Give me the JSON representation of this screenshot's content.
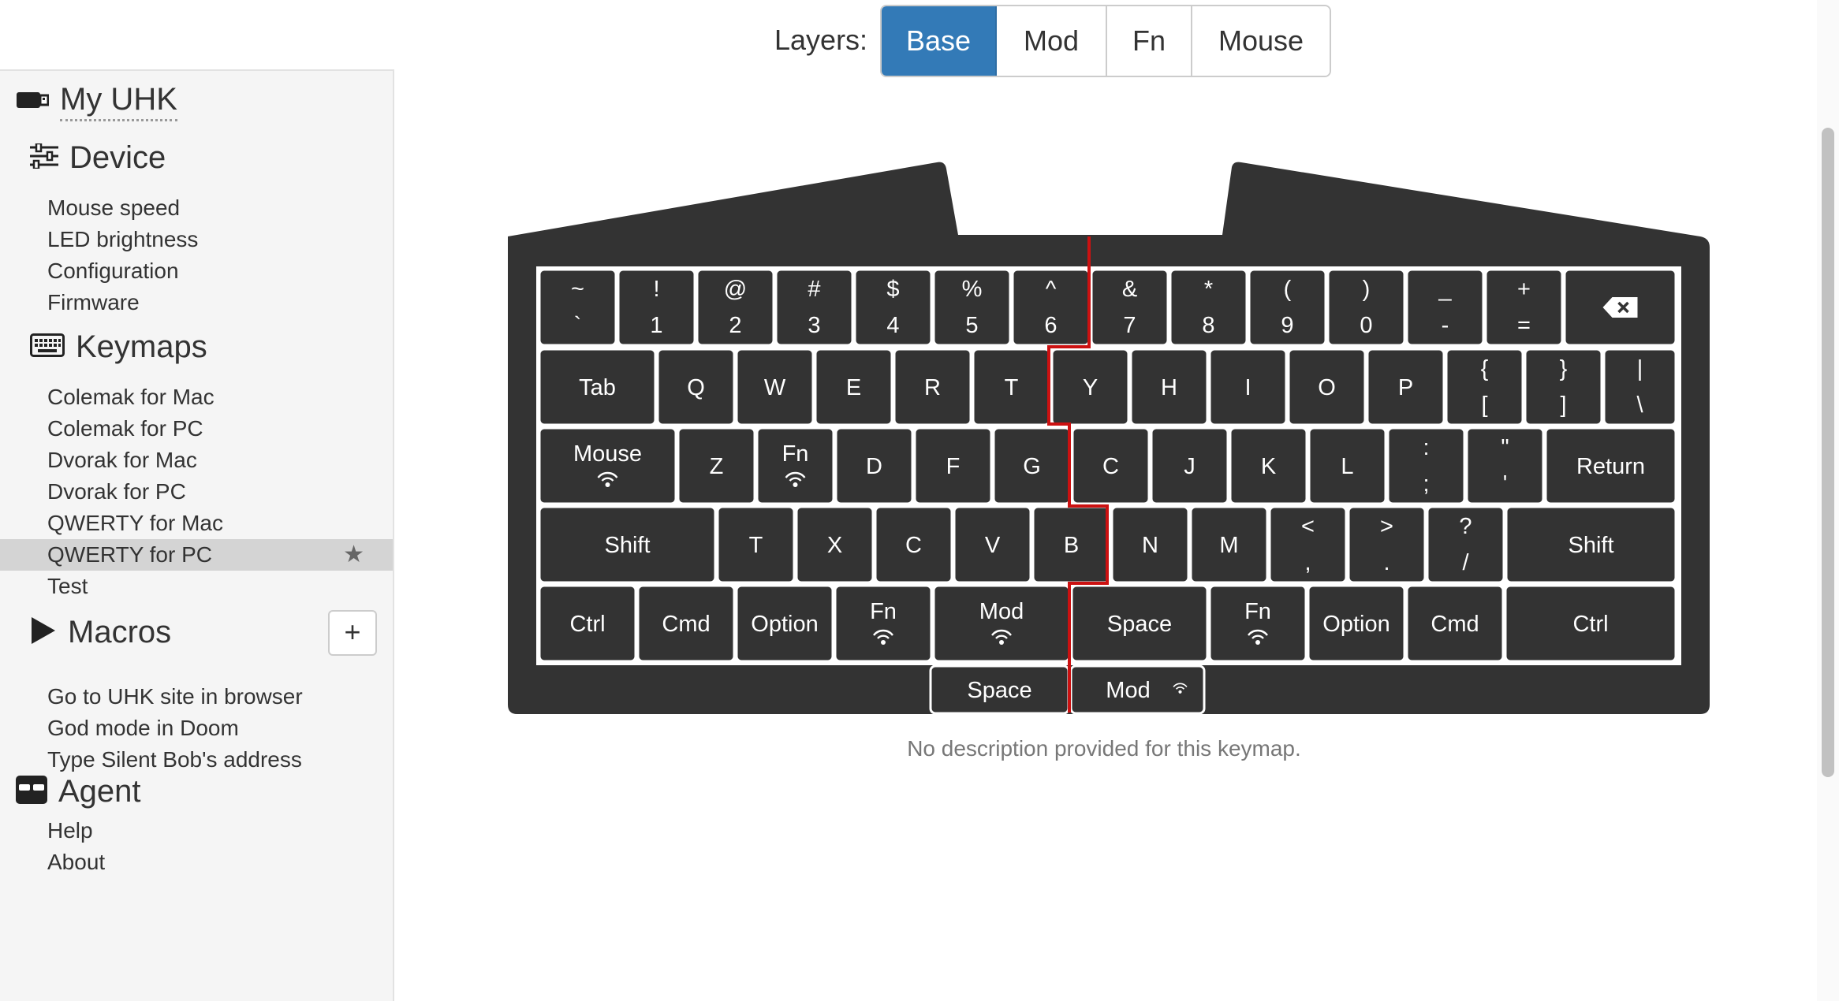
{
  "layers": {
    "label": "Layers:",
    "buttons": [
      "Base",
      "Mod",
      "Fn",
      "Mouse"
    ],
    "active": "Base"
  },
  "sidebar": {
    "my_uhk": "My UHK",
    "device": {
      "title": "Device",
      "items": [
        "Mouse speed",
        "LED brightness",
        "Configuration",
        "Firmware"
      ]
    },
    "keymaps": {
      "title": "Keymaps",
      "items": [
        "Colemak for Mac",
        "Colemak for PC",
        "Dvorak for Mac",
        "Dvorak for PC",
        "QWERTY for Mac",
        "QWERTY for PC",
        "Test"
      ],
      "selected": "QWERTY for PC"
    },
    "macros": {
      "title": "Macros",
      "add_label": "+",
      "items": [
        "Go to UHK site in browser",
        "God mode in Doom",
        "Type Silent Bob's address"
      ]
    },
    "agent": {
      "title": "Agent",
      "items": [
        "Help",
        "About"
      ]
    }
  },
  "description": "No description provided for this keymap.",
  "colors": {
    "accent": "#337ab7",
    "key": "#333333",
    "case": "#333333",
    "split_line": "#cc1111",
    "selected_row": "#d4d4d4"
  },
  "keys": {
    "row1": [
      {
        "top": "~",
        "bottom": "`"
      },
      {
        "top": "!",
        "bottom": "1"
      },
      {
        "top": "@",
        "bottom": "2"
      },
      {
        "top": "#",
        "bottom": "3"
      },
      {
        "top": "$",
        "bottom": "4"
      },
      {
        "top": "%",
        "bottom": "5"
      },
      {
        "top": "^",
        "bottom": "6"
      },
      {
        "top": "&",
        "bottom": "7"
      },
      {
        "top": "*",
        "bottom": "8"
      },
      {
        "top": "(",
        "bottom": "9"
      },
      {
        "top": ")",
        "bottom": "0"
      },
      {
        "top": "_",
        "bottom": "-"
      },
      {
        "top": "+",
        "bottom": "="
      },
      {
        "icon": "backspace-icon"
      }
    ],
    "row2": [
      {
        "label": "Tab"
      },
      {
        "label": "Q"
      },
      {
        "label": "W"
      },
      {
        "label": "E"
      },
      {
        "label": "R"
      },
      {
        "label": "T"
      },
      {
        "label": "Y"
      },
      {
        "label": "H"
      },
      {
        "label": "I"
      },
      {
        "label": "O"
      },
      {
        "label": "P"
      },
      {
        "top": "{",
        "bottom": "["
      },
      {
        "top": "}",
        "bottom": "]"
      },
      {
        "top": "|",
        "bottom": "\\"
      }
    ],
    "row3": [
      {
        "label": "Mouse",
        "icon": "layer-switch-icon"
      },
      {
        "label": "Z"
      },
      {
        "label": "Fn",
        "icon": "layer-switch-icon"
      },
      {
        "label": "D"
      },
      {
        "label": "F"
      },
      {
        "label": "G"
      },
      {
        "label": "C"
      },
      {
        "label": "J"
      },
      {
        "label": "K"
      },
      {
        "label": "L"
      },
      {
        "top": ":",
        "bottom": ";"
      },
      {
        "top": "\"",
        "bottom": "'"
      },
      {
        "label": "Return"
      }
    ],
    "row4": [
      {
        "label": "Shift"
      },
      {
        "label": "T"
      },
      {
        "label": "X"
      },
      {
        "label": "C"
      },
      {
        "label": "V"
      },
      {
        "label": "B"
      },
      {
        "label": "N"
      },
      {
        "label": "M"
      },
      {
        "top": "<",
        "bottom": ","
      },
      {
        "top": ">",
        "bottom": "."
      },
      {
        "top": "?",
        "bottom": "/"
      },
      {
        "label": "Shift"
      }
    ],
    "row5": [
      {
        "label": "Ctrl"
      },
      {
        "label": "Cmd"
      },
      {
        "label": "Option"
      },
      {
        "label": "Fn",
        "icon": "layer-switch-icon"
      },
      {
        "label": "Mod",
        "icon": "layer-switch-icon"
      },
      {
        "label": "Space"
      },
      {
        "label": "Fn",
        "icon": "layer-switch-icon"
      },
      {
        "label": "Option"
      },
      {
        "label": "Cmd"
      },
      {
        "label": "Ctrl"
      }
    ],
    "row6": [
      {
        "label": "Space"
      },
      {
        "label": "Mod",
        "icon": "layer-switch-icon"
      }
    ]
  }
}
